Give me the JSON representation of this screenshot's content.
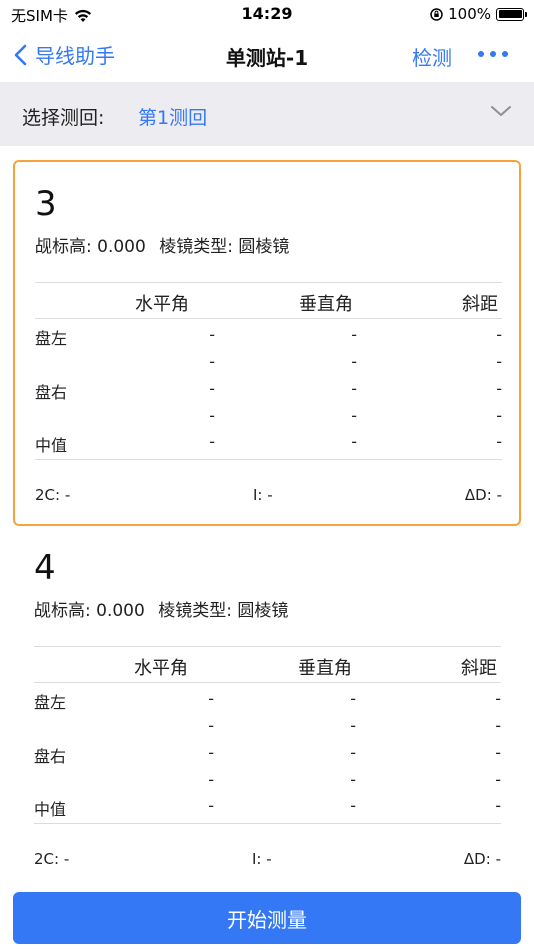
{
  "status_bar": {
    "carrier": "无SIM卡",
    "time": "14:29",
    "battery": "100%"
  },
  "nav": {
    "back_label": "导线助手",
    "title": "单测站-1",
    "check_label": "检测"
  },
  "round_selector": {
    "label": "选择测回:",
    "value": "第1测回"
  },
  "cards": [
    {
      "number": "3",
      "target_height_label": "觇标高:",
      "target_height_value": "0.000",
      "prism_type_label": "棱镜类型:",
      "prism_type_value": "圆棱镜",
      "columns": [
        "水平角",
        "垂直角",
        "斜距"
      ],
      "rows": [
        {
          "label": "盘左",
          "values": [
            "-",
            "-",
            "-"
          ]
        },
        {
          "label": "",
          "values": [
            "-",
            "-",
            "-"
          ]
        },
        {
          "label": "盘右",
          "values": [
            "-",
            "-",
            "-"
          ]
        },
        {
          "label": "",
          "values": [
            "-",
            "-",
            "-"
          ]
        },
        {
          "label": "中值",
          "values": [
            "-",
            "-",
            "-"
          ]
        }
      ],
      "footer": [
        {
          "label": "2C:",
          "value": "-"
        },
        {
          "label": "I:",
          "value": "-"
        },
        {
          "label": "ΔD:",
          "value": "-"
        }
      ]
    },
    {
      "number": "4",
      "target_height_label": "觇标高:",
      "target_height_value": "0.000",
      "prism_type_label": "棱镜类型:",
      "prism_type_value": "圆棱镜",
      "columns": [
        "水平角",
        "垂直角",
        "斜距"
      ],
      "rows": [
        {
          "label": "盘左",
          "values": [
            "-",
            "-",
            "-"
          ]
        },
        {
          "label": "",
          "values": [
            "-",
            "-",
            "-"
          ]
        },
        {
          "label": "盘右",
          "values": [
            "-",
            "-",
            "-"
          ]
        },
        {
          "label": "",
          "values": [
            "-",
            "-",
            "-"
          ]
        },
        {
          "label": "中值",
          "values": [
            "-",
            "-",
            "-"
          ]
        }
      ],
      "footer": [
        {
          "label": "2C:",
          "value": "-"
        },
        {
          "label": "I:",
          "value": "-"
        },
        {
          "label": "ΔD:",
          "value": "-"
        }
      ]
    }
  ],
  "start_button_label": "开始测量",
  "colors": {
    "accent": "#3478f6",
    "selected_border": "#f5a33a",
    "selector_bg": "#ececf1"
  }
}
